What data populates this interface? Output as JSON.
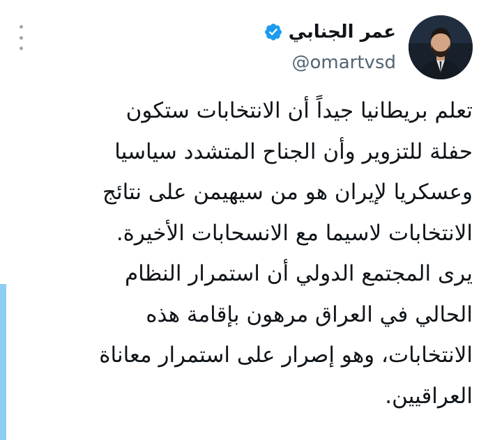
{
  "author": {
    "display_name": "عمر الجنابي",
    "handle": "@omartvsd",
    "verified": true,
    "avatar_icon": "profile-photo",
    "verified_icon": "verified-badge-icon",
    "more_icon": "more-options-icon"
  },
  "tweet": {
    "lines": [
      "تعلم بريطانيا جيداً أن الانتخابات ستكون",
      "حفلة للتزوير وأن الجناح المتشدد سياسيا",
      "وعسكريا لإيران هو من سيهيمن على نتائج",
      "الانتخابات لاسيما مع الانسحابات الأخيرة.",
      "يرى المجتمع الدولي أن استمرار النظام",
      "الحالي في العراق مرهون بإقامة هذه",
      "الانتخابات، وهو إصرار على استمرار معاناة",
      "العراقيين."
    ]
  },
  "colors": {
    "text": "#0f1419",
    "secondary_text": "#536471",
    "verified_blue": "#1d9bf0",
    "accent_bar": "#8ecdf3"
  }
}
